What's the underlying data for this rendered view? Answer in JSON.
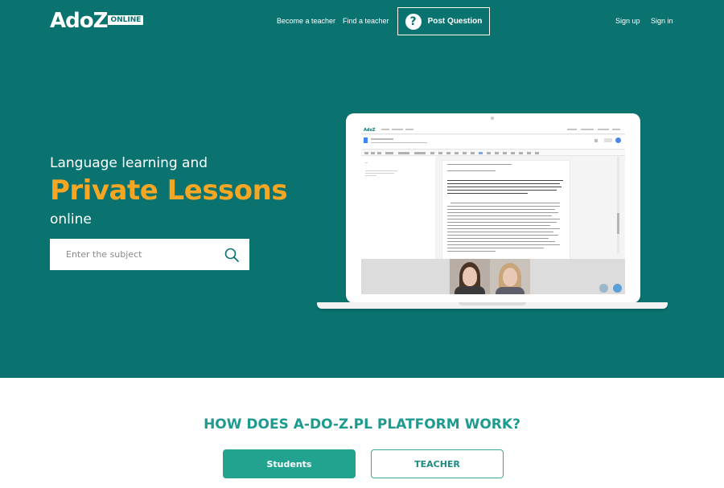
{
  "header": {
    "logo_text": "AdoZ",
    "logo_badge": "ONLINE",
    "nav": {
      "become_teacher": "Become a teacher",
      "find_teacher": "Find a teacher",
      "post_question": "Post Question",
      "sign_up": "Sign up",
      "sign_in": "Sign in"
    }
  },
  "hero": {
    "line1": "Language learning and",
    "line2": "Private Lessons",
    "line3": "online",
    "search": {
      "placeholder": "Enter the subject",
      "value": ""
    },
    "illustration": {
      "screen_logo": "AdoZ"
    }
  },
  "how_it_works": {
    "title": "HOW DOES A-DO-Z.PL PLATFORM WORK?",
    "tabs": [
      {
        "label": "Students",
        "active": true
      },
      {
        "label": "TEACHER",
        "active": false
      }
    ]
  },
  "colors": {
    "hero_background": "#0a7370",
    "accent_orange": "#f5a623",
    "title_teal": "#1d9b8e",
    "button_teal": "#21a38f"
  },
  "icons": [
    "question-icon",
    "search-icon"
  ]
}
